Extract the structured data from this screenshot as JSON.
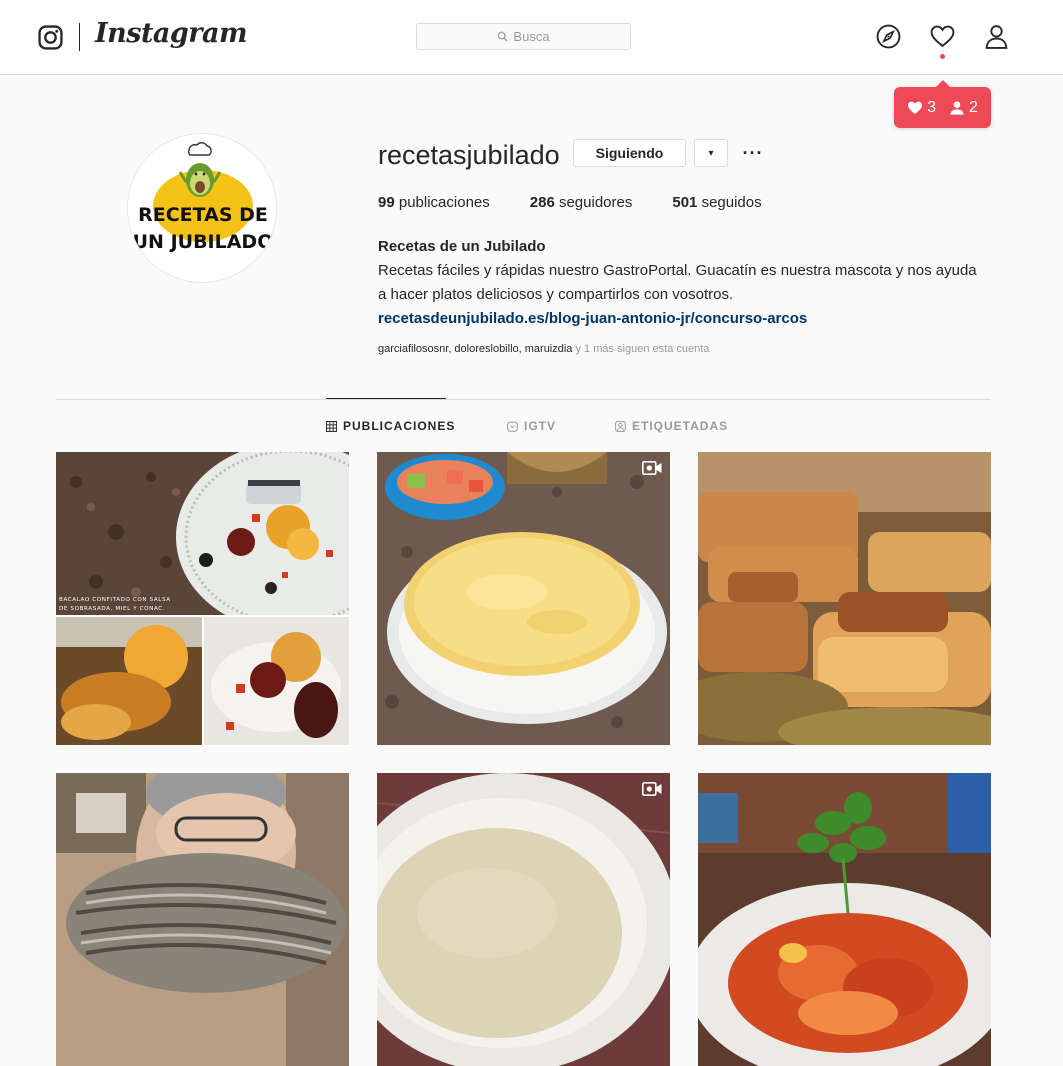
{
  "nav": {
    "logo_icon": "instagram-glyph-icon",
    "wordmark": "Instagram",
    "search_placeholder": "Busca",
    "icons": [
      "compass-icon",
      "heart-icon",
      "user-icon"
    ]
  },
  "notifications": {
    "likes": "3",
    "follows": "2",
    "color": "#ed4956"
  },
  "profile": {
    "username": "recetasjubilado",
    "follow_button": "Siguiendo",
    "dropdown_glyph": "▾",
    "more_glyph": "···",
    "avatar": {
      "line1": "RECETAS DE",
      "line2": "UN JUBILADO"
    },
    "stats": {
      "posts_count": "99",
      "posts_label": "publicaciones",
      "followers_count": "286",
      "followers_label": "seguidores",
      "following_count": "501",
      "following_label": "seguidos"
    },
    "bio": {
      "name": "Recetas de un Jubilado",
      "text": "Recetas fáciles y rápidas nuestro GastroPortal. Guacatín es nuestra mascota y nos ayuda a hacer platos deliciosos y compartirlos con vosotros.",
      "link": "recetasdeunjubilado.es/blog-juan-antonio-jr/concurso-arcos"
    },
    "followed_by": {
      "names": "garciafilososnr, doloreslobillo, maruizdia",
      "suffix": " y 1 más siguen esta cuenta"
    }
  },
  "tabs": [
    {
      "label": "PUBLICACIONES",
      "icon": "grid-icon",
      "active": true
    },
    {
      "label": "IGTV",
      "icon": "igtv-icon",
      "active": false
    },
    {
      "label": "ETIQUETADAS",
      "icon": "tagged-icon",
      "active": false
    }
  ],
  "posts": [
    {
      "caption_overlay": "BACALAO CONFITADO CON SALSA DE SOBRASADA, MIEL Y CONAC.",
      "video": false
    },
    {
      "caption_overlay": "",
      "video": true
    },
    {
      "caption_overlay": "",
      "video": false
    },
    {
      "caption_overlay": "",
      "video": false
    },
    {
      "caption_overlay": "",
      "video": true
    },
    {
      "caption_overlay": "",
      "video": false
    }
  ],
  "colors": {
    "link": "#003569",
    "border": "#dbdbdb",
    "muted": "#999999",
    "avatar_yellow": "#f5c218"
  }
}
